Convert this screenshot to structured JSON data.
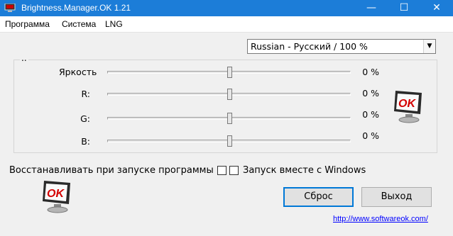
{
  "window": {
    "title": "Brightness.Manager.OK 1.21",
    "minimize_glyph": "—",
    "maximize_glyph": "☐",
    "close_glyph": "✕",
    "icon": "app-monitor-icon"
  },
  "menu": {
    "items": [
      "Программа",
      "Система",
      "LNG"
    ]
  },
  "language_select": {
    "value": "Russian - Русский / 100 %",
    "arrow_glyph": "▼"
  },
  "group": {
    "caption": ".."
  },
  "sliders": [
    {
      "label": "Яркость",
      "value_text": "0 %",
      "level_percent": 0
    },
    {
      "label": "R:",
      "value_text": "0 %",
      "level_percent": 0
    },
    {
      "label": "G:",
      "value_text": "0 %",
      "level_percent": 0
    },
    {
      "label": "B:",
      "value_text": "0 %",
      "level_percent": 0
    }
  ],
  "options": {
    "restore_label": "Восстанавливать при запуске программы",
    "restore_checked": false,
    "autostart_label": "Запуск вместе с Windows",
    "autostart_checked": false
  },
  "buttons": {
    "reset": "Сброс",
    "exit": "Выход"
  },
  "link": "http://www.softwareok.com/",
  "logo": {
    "text": "OK",
    "icon": "ok-monitor-logo-icon"
  },
  "colors": {
    "titlebar": "#1c7dd8",
    "logo_red": "#d40000",
    "link": "#0000ff",
    "accent_border": "#0078d7"
  }
}
